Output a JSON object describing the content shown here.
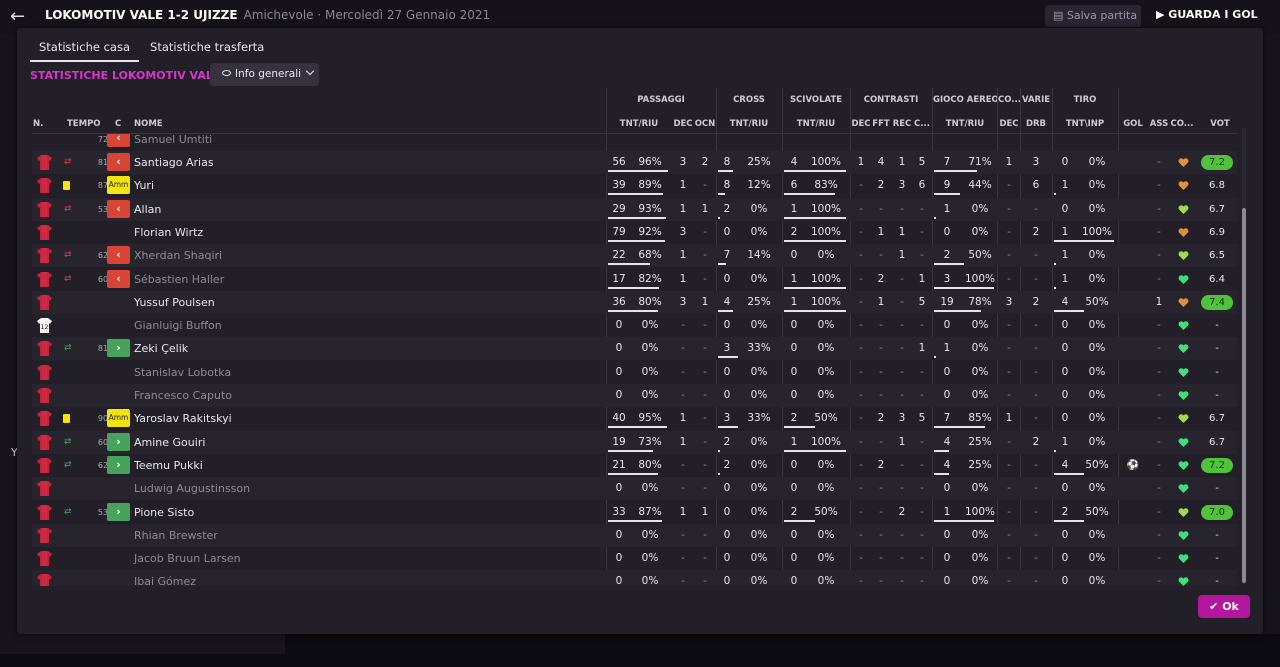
{
  "topbar": {
    "title": "LOKOMOTIV VALE 1-2 UJIZZE",
    "subtitle": "Amichevole · Mercoledì 27 Gennaio 2021",
    "save_label": "Salva partita",
    "watch_label": "GUARDA I GOL"
  },
  "background_text": "Y",
  "tabs": [
    {
      "label": "Statistiche casa",
      "active": true
    },
    {
      "label": "Statistiche trasferta",
      "active": false
    }
  ],
  "section_title": "STATISTICHE LOKOMOTIV VALE",
  "dropdown_label": "Info generali",
  "groups": {
    "passaggi": "PASSAGGI",
    "cross": "CROSS",
    "scivolate": "SCIVOLATE",
    "contrasti": "CONTRASTI",
    "gioco_aereo": "GIOCO AEREO",
    "co": "CO...",
    "varie": "VARIE",
    "tiro": "TIRO"
  },
  "columns": {
    "n": "N.",
    "tempo": "TEMPO",
    "c": "C",
    "nome": "NOME",
    "pass_tnt": "TNT/RIU",
    "pass_dec": "DEC",
    "pass_ocn": "OCN",
    "cross_tnt": "TNT/RIU",
    "sciv_tnt": "TNT/RIU",
    "con_dec": "DEC",
    "con_fft": "FFT",
    "con_rec": "REC",
    "con_c": "C...",
    "aereo_tnt": "TNT/RIU",
    "co_dec": "DEC",
    "varie_drb": "DRB",
    "tiro_tnt": "TNT\\INP",
    "gol": "GOL",
    "ass": "ASS",
    "cond": "CO...",
    "vot": "VOT"
  },
  "colors": {
    "accent": "#d537c8",
    "ok_button": "#b4179e",
    "sub_out": "#d84436",
    "sub_in": "#48a35a",
    "yellow_card": "#f2e40c",
    "vote_high": "#4fc43a"
  },
  "partial_row": {
    "name": "Samuel Umtiti",
    "time": "72"
  },
  "players": [
    {
      "name": "Santiago Arias",
      "sub": "out",
      "card": false,
      "time": "81",
      "gk": false,
      "dim": false,
      "pass": "56",
      "pass_pct": "96%",
      "pass_dec": "3",
      "pass_ocn": "2",
      "cross": "8",
      "cross_pct": "25%",
      "sciv": "4",
      "sciv_pct": "100%",
      "con_dec": "1",
      "con_fft": "4",
      "con_rec": "1",
      "con_c": "5",
      "aereo": "7",
      "aereo_pct": "71%",
      "co_dec": "1",
      "drb": "3",
      "tiro": "0",
      "tiro_pct": "0%",
      "gol": "",
      "ass": "-",
      "cond": "orange",
      "vote": "7.2",
      "vote_pill": true
    },
    {
      "name": "Yuri",
      "sub": "amm",
      "card": true,
      "time": "87",
      "gk": false,
      "dim": false,
      "pass": "39",
      "pass_pct": "89%",
      "pass_dec": "1",
      "pass_ocn": "-",
      "cross": "8",
      "cross_pct": "12%",
      "sciv": "6",
      "sciv_pct": "83%",
      "con_dec": "-",
      "con_fft": "2",
      "con_rec": "3",
      "con_c": "6",
      "aereo": "9",
      "aereo_pct": "44%",
      "co_dec": "-",
      "drb": "6",
      "tiro": "1",
      "tiro_pct": "0%",
      "gol": "",
      "ass": "-",
      "cond": "orange",
      "vote": "6.8",
      "vote_pill": false
    },
    {
      "name": "Allan",
      "sub": "out",
      "card": false,
      "time": "53",
      "gk": false,
      "dim": false,
      "pass": "29",
      "pass_pct": "93%",
      "pass_dec": "1",
      "pass_ocn": "1",
      "cross": "2",
      "cross_pct": "0%",
      "sciv": "1",
      "sciv_pct": "100%",
      "con_dec": "-",
      "con_fft": "-",
      "con_rec": "-",
      "con_c": "-",
      "aereo": "1",
      "aereo_pct": "0%",
      "co_dec": "-",
      "drb": "-",
      "tiro": "0",
      "tiro_pct": "0%",
      "gol": "",
      "ass": "-",
      "cond": "lime",
      "vote": "6.7",
      "vote_pill": false
    },
    {
      "name": "Florian Wirtz",
      "sub": "",
      "card": false,
      "time": "",
      "gk": false,
      "dim": false,
      "pass": "79",
      "pass_pct": "92%",
      "pass_dec": "3",
      "pass_ocn": "-",
      "cross": "0",
      "cross_pct": "0%",
      "sciv": "2",
      "sciv_pct": "100%",
      "con_dec": "-",
      "con_fft": "1",
      "con_rec": "1",
      "con_c": "-",
      "aereo": "0",
      "aereo_pct": "0%",
      "co_dec": "-",
      "drb": "2",
      "tiro": "1",
      "tiro_pct": "100%",
      "gol": "",
      "ass": "-",
      "cond": "orange",
      "vote": "6.9",
      "vote_pill": false
    },
    {
      "name": "Xherdan Shaqiri",
      "sub": "out",
      "card": false,
      "time": "62",
      "gk": false,
      "dim": true,
      "pass": "22",
      "pass_pct": "68%",
      "pass_dec": "1",
      "pass_ocn": "-",
      "cross": "7",
      "cross_pct": "14%",
      "sciv": "0",
      "sciv_pct": "0%",
      "con_dec": "-",
      "con_fft": "-",
      "con_rec": "1",
      "con_c": "-",
      "aereo": "2",
      "aereo_pct": "50%",
      "co_dec": "-",
      "drb": "-",
      "tiro": "1",
      "tiro_pct": "0%",
      "gol": "",
      "ass": "-",
      "cond": "lime",
      "vote": "6.5",
      "vote_pill": false
    },
    {
      "name": "Sébastien Haller",
      "sub": "out",
      "card": false,
      "time": "60",
      "gk": false,
      "dim": true,
      "pass": "17",
      "pass_pct": "82%",
      "pass_dec": "1",
      "pass_ocn": "-",
      "cross": "0",
      "cross_pct": "0%",
      "sciv": "1",
      "sciv_pct": "100%",
      "con_dec": "-",
      "con_fft": "2",
      "con_rec": "-",
      "con_c": "1",
      "aereo": "3",
      "aereo_pct": "100%",
      "co_dec": "-",
      "drb": "-",
      "tiro": "1",
      "tiro_pct": "0%",
      "gol": "",
      "ass": "-",
      "cond": "green",
      "vote": "6.4",
      "vote_pill": false
    },
    {
      "name": "Yussuf Poulsen",
      "sub": "",
      "card": false,
      "time": "",
      "gk": false,
      "dim": false,
      "pass": "36",
      "pass_pct": "80%",
      "pass_dec": "3",
      "pass_ocn": "1",
      "cross": "4",
      "cross_pct": "25%",
      "sciv": "1",
      "sciv_pct": "100%",
      "con_dec": "-",
      "con_fft": "1",
      "con_rec": "-",
      "con_c": "5",
      "aereo": "19",
      "aereo_pct": "78%",
      "co_dec": "3",
      "drb": "2",
      "tiro": "4",
      "tiro_pct": "50%",
      "gol": "",
      "ass": "1",
      "cond": "orange",
      "vote": "7.4",
      "vote_pill": true
    },
    {
      "name": "Gianluigi Buffon",
      "sub": "",
      "card": false,
      "time": "",
      "gk": true,
      "dim": true,
      "pass": "0",
      "pass_pct": "0%",
      "pass_dec": "-",
      "pass_ocn": "-",
      "cross": "0",
      "cross_pct": "0%",
      "sciv": "0",
      "sciv_pct": "0%",
      "con_dec": "-",
      "con_fft": "-",
      "con_rec": "-",
      "con_c": "-",
      "aereo": "0",
      "aereo_pct": "0%",
      "co_dec": "-",
      "drb": "-",
      "tiro": "0",
      "tiro_pct": "0%",
      "gol": "",
      "ass": "-",
      "cond": "green",
      "vote": "-",
      "vote_pill": false
    },
    {
      "name": "Zeki Çelik",
      "sub": "in",
      "card": false,
      "time": "81",
      "gk": false,
      "dim": false,
      "pass": "0",
      "pass_pct": "0%",
      "pass_dec": "-",
      "pass_ocn": "-",
      "cross": "3",
      "cross_pct": "33%",
      "sciv": "0",
      "sciv_pct": "0%",
      "con_dec": "-",
      "con_fft": "-",
      "con_rec": "-",
      "con_c": "1",
      "aereo": "1",
      "aereo_pct": "0%",
      "co_dec": "-",
      "drb": "-",
      "tiro": "0",
      "tiro_pct": "0%",
      "gol": "",
      "ass": "-",
      "cond": "green",
      "vote": "-",
      "vote_pill": false
    },
    {
      "name": "Stanislav Lobotka",
      "sub": "",
      "card": false,
      "time": "",
      "gk": false,
      "dim": true,
      "pass": "0",
      "pass_pct": "0%",
      "pass_dec": "-",
      "pass_ocn": "-",
      "cross": "0",
      "cross_pct": "0%",
      "sciv": "0",
      "sciv_pct": "0%",
      "con_dec": "-",
      "con_fft": "-",
      "con_rec": "-",
      "con_c": "-",
      "aereo": "0",
      "aereo_pct": "0%",
      "co_dec": "-",
      "drb": "-",
      "tiro": "0",
      "tiro_pct": "0%",
      "gol": "",
      "ass": "-",
      "cond": "green",
      "vote": "-",
      "vote_pill": false
    },
    {
      "name": "Francesco Caputo",
      "sub": "",
      "card": false,
      "time": "",
      "gk": false,
      "dim": true,
      "pass": "0",
      "pass_pct": "0%",
      "pass_dec": "-",
      "pass_ocn": "-",
      "cross": "0",
      "cross_pct": "0%",
      "sciv": "0",
      "sciv_pct": "0%",
      "con_dec": "-",
      "con_fft": "-",
      "con_rec": "-",
      "con_c": "-",
      "aereo": "0",
      "aereo_pct": "0%",
      "co_dec": "-",
      "drb": "-",
      "tiro": "0",
      "tiro_pct": "0%",
      "gol": "",
      "ass": "-",
      "cond": "green",
      "vote": "-",
      "vote_pill": false
    },
    {
      "name": "Yaroslav Rakitskyi",
      "sub": "amm",
      "card": true,
      "time": "90",
      "gk": false,
      "dim": false,
      "pass": "40",
      "pass_pct": "95%",
      "pass_dec": "1",
      "pass_ocn": "-",
      "cross": "3",
      "cross_pct": "33%",
      "sciv": "2",
      "sciv_pct": "50%",
      "con_dec": "-",
      "con_fft": "2",
      "con_rec": "3",
      "con_c": "5",
      "aereo": "7",
      "aereo_pct": "85%",
      "co_dec": "1",
      "drb": "-",
      "tiro": "0",
      "tiro_pct": "0%",
      "gol": "",
      "ass": "-",
      "cond": "lime",
      "vote": "6.7",
      "vote_pill": false
    },
    {
      "name": "Amine Gouiri",
      "sub": "in",
      "card": false,
      "time": "60",
      "gk": false,
      "dim": false,
      "pass": "19",
      "pass_pct": "73%",
      "pass_dec": "1",
      "pass_ocn": "-",
      "cross": "2",
      "cross_pct": "0%",
      "sciv": "1",
      "sciv_pct": "100%",
      "con_dec": "-",
      "con_fft": "-",
      "con_rec": "1",
      "con_c": "-",
      "aereo": "4",
      "aereo_pct": "25%",
      "co_dec": "-",
      "drb": "2",
      "tiro": "1",
      "tiro_pct": "0%",
      "gol": "",
      "ass": "-",
      "cond": "green",
      "vote": "6.7",
      "vote_pill": false
    },
    {
      "name": "Teemu Pukki",
      "sub": "in",
      "card": false,
      "time": "62",
      "gk": false,
      "dim": false,
      "pass": "21",
      "pass_pct": "80%",
      "pass_dec": "-",
      "pass_ocn": "-",
      "cross": "2",
      "cross_pct": "0%",
      "sciv": "0",
      "sciv_pct": "0%",
      "con_dec": "-",
      "con_fft": "2",
      "con_rec": "-",
      "con_c": "-",
      "aereo": "4",
      "aereo_pct": "25%",
      "co_dec": "-",
      "drb": "-",
      "tiro": "4",
      "tiro_pct": "50%",
      "gol": "ball",
      "ass": "-",
      "cond": "green",
      "vote": "7.2",
      "vote_pill": true
    },
    {
      "name": "Ludwig Augustinsson",
      "sub": "",
      "card": false,
      "time": "",
      "gk": false,
      "dim": true,
      "pass": "0",
      "pass_pct": "0%",
      "pass_dec": "-",
      "pass_ocn": "-",
      "cross": "0",
      "cross_pct": "0%",
      "sciv": "0",
      "sciv_pct": "0%",
      "con_dec": "-",
      "con_fft": "-",
      "con_rec": "-",
      "con_c": "-",
      "aereo": "0",
      "aereo_pct": "0%",
      "co_dec": "-",
      "drb": "-",
      "tiro": "0",
      "tiro_pct": "0%",
      "gol": "",
      "ass": "-",
      "cond": "green",
      "vote": "-",
      "vote_pill": false
    },
    {
      "name": "Pione Sisto",
      "sub": "in",
      "card": false,
      "time": "53",
      "gk": false,
      "dim": false,
      "pass": "33",
      "pass_pct": "87%",
      "pass_dec": "1",
      "pass_ocn": "1",
      "cross": "0",
      "cross_pct": "0%",
      "sciv": "2",
      "sciv_pct": "50%",
      "con_dec": "-",
      "con_fft": "-",
      "con_rec": "2",
      "con_c": "-",
      "aereo": "1",
      "aereo_pct": "100%",
      "co_dec": "-",
      "drb": "-",
      "tiro": "2",
      "tiro_pct": "50%",
      "gol": "",
      "ass": "-",
      "cond": "lime",
      "vote": "7.0",
      "vote_pill": true
    },
    {
      "name": "Rhian Brewster",
      "sub": "",
      "card": false,
      "time": "",
      "gk": false,
      "dim": true,
      "pass": "0",
      "pass_pct": "0%",
      "pass_dec": "-",
      "pass_ocn": "-",
      "cross": "0",
      "cross_pct": "0%",
      "sciv": "0",
      "sciv_pct": "0%",
      "con_dec": "-",
      "con_fft": "-",
      "con_rec": "-",
      "con_c": "-",
      "aereo": "0",
      "aereo_pct": "0%",
      "co_dec": "-",
      "drb": "-",
      "tiro": "0",
      "tiro_pct": "0%",
      "gol": "",
      "ass": "-",
      "cond": "green",
      "vote": "-",
      "vote_pill": false
    },
    {
      "name": "Jacob Bruun Larsen",
      "sub": "",
      "card": false,
      "time": "",
      "gk": false,
      "dim": true,
      "pass": "0",
      "pass_pct": "0%",
      "pass_dec": "-",
      "pass_ocn": "-",
      "cross": "0",
      "cross_pct": "0%",
      "sciv": "0",
      "sciv_pct": "0%",
      "con_dec": "-",
      "con_fft": "-",
      "con_rec": "-",
      "con_c": "-",
      "aereo": "0",
      "aereo_pct": "0%",
      "co_dec": "-",
      "drb": "-",
      "tiro": "0",
      "tiro_pct": "0%",
      "gol": "",
      "ass": "-",
      "cond": "green",
      "vote": "-",
      "vote_pill": false
    },
    {
      "name": "Ibai Gómez",
      "sub": "",
      "card": false,
      "time": "",
      "gk": false,
      "dim": true,
      "pass": "0",
      "pass_pct": "0%",
      "pass_dec": "-",
      "pass_ocn": "-",
      "cross": "0",
      "cross_pct": "0%",
      "sciv": "0",
      "sciv_pct": "0%",
      "con_dec": "-",
      "con_fft": "-",
      "con_rec": "-",
      "con_c": "-",
      "aereo": "0",
      "aereo_pct": "0%",
      "co_dec": "-",
      "drb": "-",
      "tiro": "0",
      "tiro_pct": "0%",
      "gol": "",
      "ass": "-",
      "cond": "green",
      "vote": "-",
      "vote_pill": false
    }
  ],
  "ok_label": "Ok"
}
